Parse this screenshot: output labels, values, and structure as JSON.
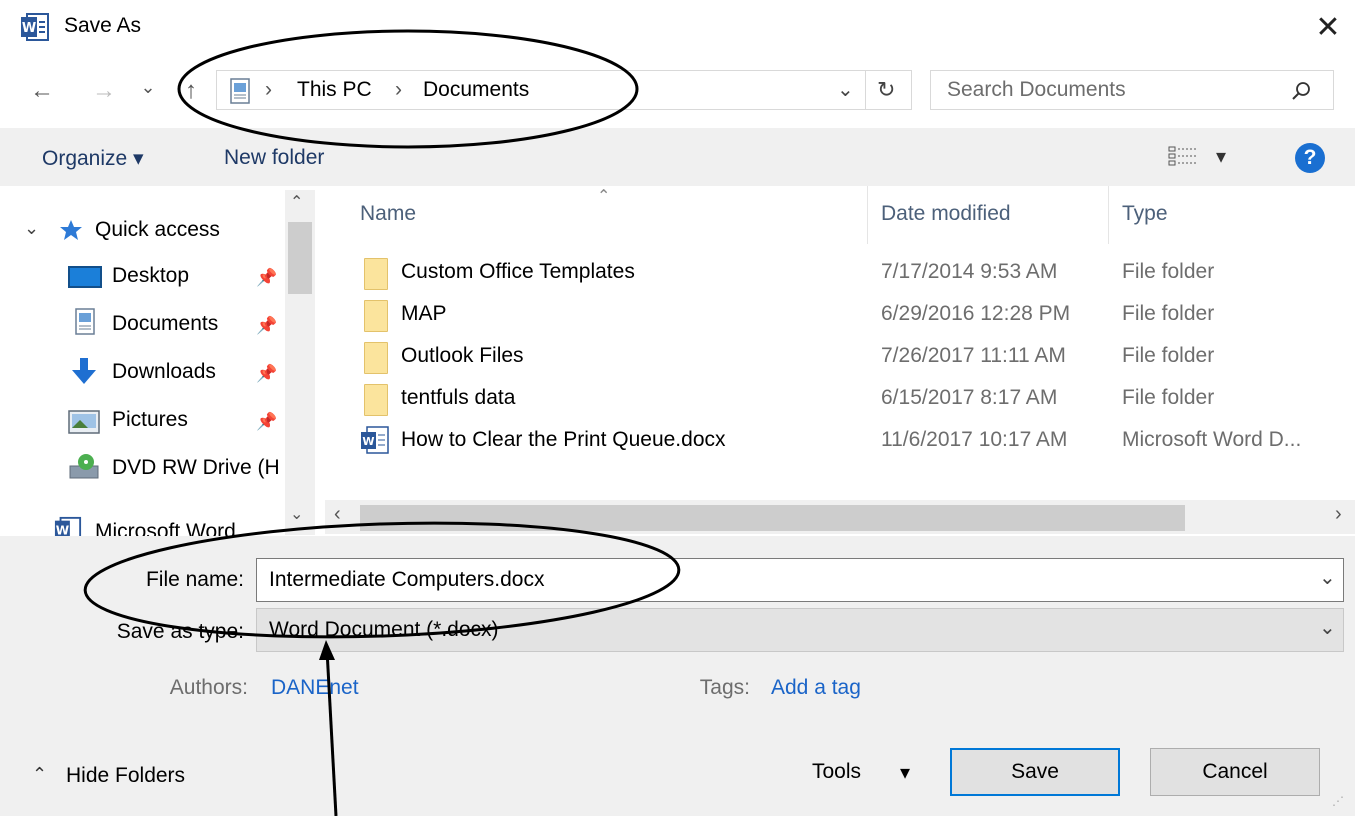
{
  "window": {
    "title": "Save As",
    "app_icon": "word-icon",
    "close_glyph": "✕"
  },
  "navigation": {
    "back_glyph": "←",
    "forward_glyph": "→",
    "recent_glyph": "⌄",
    "up_glyph": "↑",
    "breadcrumb": [
      "This PC",
      "Documents"
    ],
    "separator": "›",
    "search_placeholder": "Search Documents"
  },
  "toolbar": {
    "organize_label": "Organize ▾",
    "new_folder_label": "New folder",
    "view_glyph": "▾",
    "help_glyph": "?"
  },
  "sidebar": {
    "quick_access_label": "Quick access",
    "items": [
      {
        "label": "Desktop",
        "icon": "desktop-icon",
        "pinned": true
      },
      {
        "label": "Documents",
        "icon": "documents-icon",
        "pinned": true
      },
      {
        "label": "Downloads",
        "icon": "downloads-icon",
        "pinned": true
      },
      {
        "label": "Pictures",
        "icon": "pictures-icon",
        "pinned": true
      },
      {
        "label": "DVD RW Drive (H",
        "icon": "dvd-drive-icon",
        "pinned": false
      }
    ],
    "partial_item_label": "Microsoft Word"
  },
  "file_list": {
    "columns": [
      "Name",
      "Date modified",
      "Type"
    ],
    "rows": [
      {
        "name": "Custom Office Templates",
        "date": "7/17/2014 9:53 AM",
        "type": "File folder",
        "icon": "folder-icon"
      },
      {
        "name": "MAP",
        "date": "6/29/2016 12:28 PM",
        "type": "File folder",
        "icon": "folder-icon"
      },
      {
        "name": "Outlook Files",
        "date": "7/26/2017 11:11 AM",
        "type": "File folder",
        "icon": "folder-icon"
      },
      {
        "name": "tentfuls data",
        "date": "6/15/2017 8:17 AM",
        "type": "File folder",
        "icon": "folder-icon"
      },
      {
        "name": "How to Clear the Print Queue.docx",
        "date": "11/6/2017 10:17 AM",
        "type": "Microsoft Word D...",
        "icon": "word-doc-icon"
      }
    ]
  },
  "form": {
    "file_name_label": "File name:",
    "file_name_value": "Intermediate Computers.docx",
    "save_type_label": "Save as type:",
    "save_type_value": "Word Document (*.docx)",
    "authors_label": "Authors:",
    "authors_value": "DANEnet",
    "tags_label": "Tags:",
    "tags_value": "Add a tag"
  },
  "footer": {
    "hide_folders_label": "Hide Folders",
    "tools_label": "Tools",
    "save_label": "Save",
    "cancel_label": "Cancel"
  },
  "colors": {
    "accent": "#0078d7",
    "link": "#1a64c8",
    "annotation": "#000000"
  }
}
